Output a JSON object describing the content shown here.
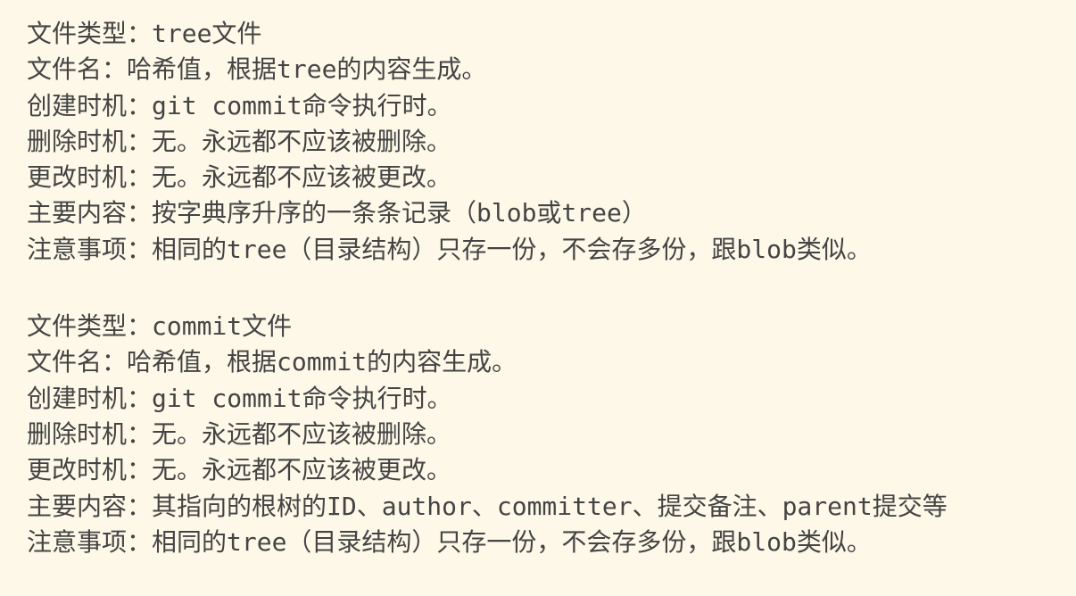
{
  "blocks": [
    {
      "lines": [
        "文件类型：tree文件",
        "文件名：哈希值，根据tree的内容生成。",
        "创建时机：git commit命令执行时。",
        "删除时机：无。永远都不应该被删除。",
        "更改时机：无。永远都不应该被更改。",
        "主要内容：按字典序升序的一条条记录（blob或tree）",
        "注意事项：相同的tree（目录结构）只存一份，不会存多份，跟blob类似。"
      ]
    },
    {
      "lines": [
        "文件类型：commit文件",
        "文件名：哈希值，根据commit的内容生成。",
        "创建时机：git commit命令执行时。",
        "删除时机：无。永远都不应该被删除。",
        "更改时机：无。永远都不应该被更改。",
        "主要内容：其指向的根树的ID、author、committer、提交备注、parent提交等",
        "注意事项：相同的tree（目录结构）只存一份，不会存多份，跟blob类似。"
      ]
    }
  ]
}
